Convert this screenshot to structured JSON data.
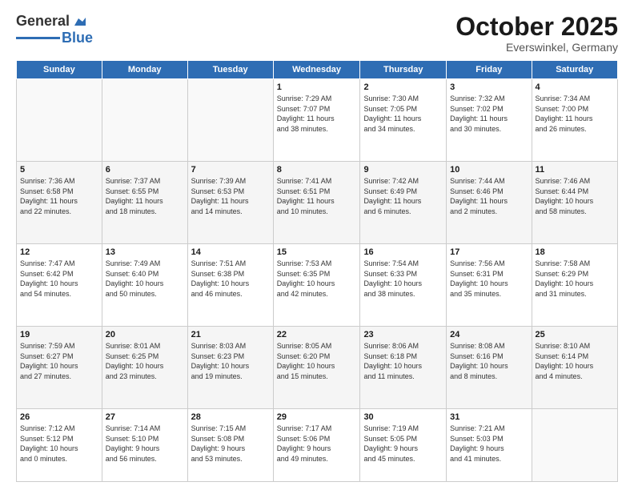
{
  "header": {
    "logo_general": "General",
    "logo_blue": "Blue",
    "title": "October 2025",
    "location": "Everswinkel, Germany"
  },
  "weekdays": [
    "Sunday",
    "Monday",
    "Tuesday",
    "Wednesday",
    "Thursday",
    "Friday",
    "Saturday"
  ],
  "weeks": [
    [
      {
        "day": "",
        "info": ""
      },
      {
        "day": "",
        "info": ""
      },
      {
        "day": "",
        "info": ""
      },
      {
        "day": "1",
        "info": "Sunrise: 7:29 AM\nSunset: 7:07 PM\nDaylight: 11 hours\nand 38 minutes."
      },
      {
        "day": "2",
        "info": "Sunrise: 7:30 AM\nSunset: 7:05 PM\nDaylight: 11 hours\nand 34 minutes."
      },
      {
        "day": "3",
        "info": "Sunrise: 7:32 AM\nSunset: 7:02 PM\nDaylight: 11 hours\nand 30 minutes."
      },
      {
        "day": "4",
        "info": "Sunrise: 7:34 AM\nSunset: 7:00 PM\nDaylight: 11 hours\nand 26 minutes."
      }
    ],
    [
      {
        "day": "5",
        "info": "Sunrise: 7:36 AM\nSunset: 6:58 PM\nDaylight: 11 hours\nand 22 minutes."
      },
      {
        "day": "6",
        "info": "Sunrise: 7:37 AM\nSunset: 6:55 PM\nDaylight: 11 hours\nand 18 minutes."
      },
      {
        "day": "7",
        "info": "Sunrise: 7:39 AM\nSunset: 6:53 PM\nDaylight: 11 hours\nand 14 minutes."
      },
      {
        "day": "8",
        "info": "Sunrise: 7:41 AM\nSunset: 6:51 PM\nDaylight: 11 hours\nand 10 minutes."
      },
      {
        "day": "9",
        "info": "Sunrise: 7:42 AM\nSunset: 6:49 PM\nDaylight: 11 hours\nand 6 minutes."
      },
      {
        "day": "10",
        "info": "Sunrise: 7:44 AM\nSunset: 6:46 PM\nDaylight: 11 hours\nand 2 minutes."
      },
      {
        "day": "11",
        "info": "Sunrise: 7:46 AM\nSunset: 6:44 PM\nDaylight: 10 hours\nand 58 minutes."
      }
    ],
    [
      {
        "day": "12",
        "info": "Sunrise: 7:47 AM\nSunset: 6:42 PM\nDaylight: 10 hours\nand 54 minutes."
      },
      {
        "day": "13",
        "info": "Sunrise: 7:49 AM\nSunset: 6:40 PM\nDaylight: 10 hours\nand 50 minutes."
      },
      {
        "day": "14",
        "info": "Sunrise: 7:51 AM\nSunset: 6:38 PM\nDaylight: 10 hours\nand 46 minutes."
      },
      {
        "day": "15",
        "info": "Sunrise: 7:53 AM\nSunset: 6:35 PM\nDaylight: 10 hours\nand 42 minutes."
      },
      {
        "day": "16",
        "info": "Sunrise: 7:54 AM\nSunset: 6:33 PM\nDaylight: 10 hours\nand 38 minutes."
      },
      {
        "day": "17",
        "info": "Sunrise: 7:56 AM\nSunset: 6:31 PM\nDaylight: 10 hours\nand 35 minutes."
      },
      {
        "day": "18",
        "info": "Sunrise: 7:58 AM\nSunset: 6:29 PM\nDaylight: 10 hours\nand 31 minutes."
      }
    ],
    [
      {
        "day": "19",
        "info": "Sunrise: 7:59 AM\nSunset: 6:27 PM\nDaylight: 10 hours\nand 27 minutes."
      },
      {
        "day": "20",
        "info": "Sunrise: 8:01 AM\nSunset: 6:25 PM\nDaylight: 10 hours\nand 23 minutes."
      },
      {
        "day": "21",
        "info": "Sunrise: 8:03 AM\nSunset: 6:23 PM\nDaylight: 10 hours\nand 19 minutes."
      },
      {
        "day": "22",
        "info": "Sunrise: 8:05 AM\nSunset: 6:20 PM\nDaylight: 10 hours\nand 15 minutes."
      },
      {
        "day": "23",
        "info": "Sunrise: 8:06 AM\nSunset: 6:18 PM\nDaylight: 10 hours\nand 11 minutes."
      },
      {
        "day": "24",
        "info": "Sunrise: 8:08 AM\nSunset: 6:16 PM\nDaylight: 10 hours\nand 8 minutes."
      },
      {
        "day": "25",
        "info": "Sunrise: 8:10 AM\nSunset: 6:14 PM\nDaylight: 10 hours\nand 4 minutes."
      }
    ],
    [
      {
        "day": "26",
        "info": "Sunrise: 7:12 AM\nSunset: 5:12 PM\nDaylight: 10 hours\nand 0 minutes."
      },
      {
        "day": "27",
        "info": "Sunrise: 7:14 AM\nSunset: 5:10 PM\nDaylight: 9 hours\nand 56 minutes."
      },
      {
        "day": "28",
        "info": "Sunrise: 7:15 AM\nSunset: 5:08 PM\nDaylight: 9 hours\nand 53 minutes."
      },
      {
        "day": "29",
        "info": "Sunrise: 7:17 AM\nSunset: 5:06 PM\nDaylight: 9 hours\nand 49 minutes."
      },
      {
        "day": "30",
        "info": "Sunrise: 7:19 AM\nSunset: 5:05 PM\nDaylight: 9 hours\nand 45 minutes."
      },
      {
        "day": "31",
        "info": "Sunrise: 7:21 AM\nSunset: 5:03 PM\nDaylight: 9 hours\nand 41 minutes."
      },
      {
        "day": "",
        "info": ""
      }
    ]
  ]
}
